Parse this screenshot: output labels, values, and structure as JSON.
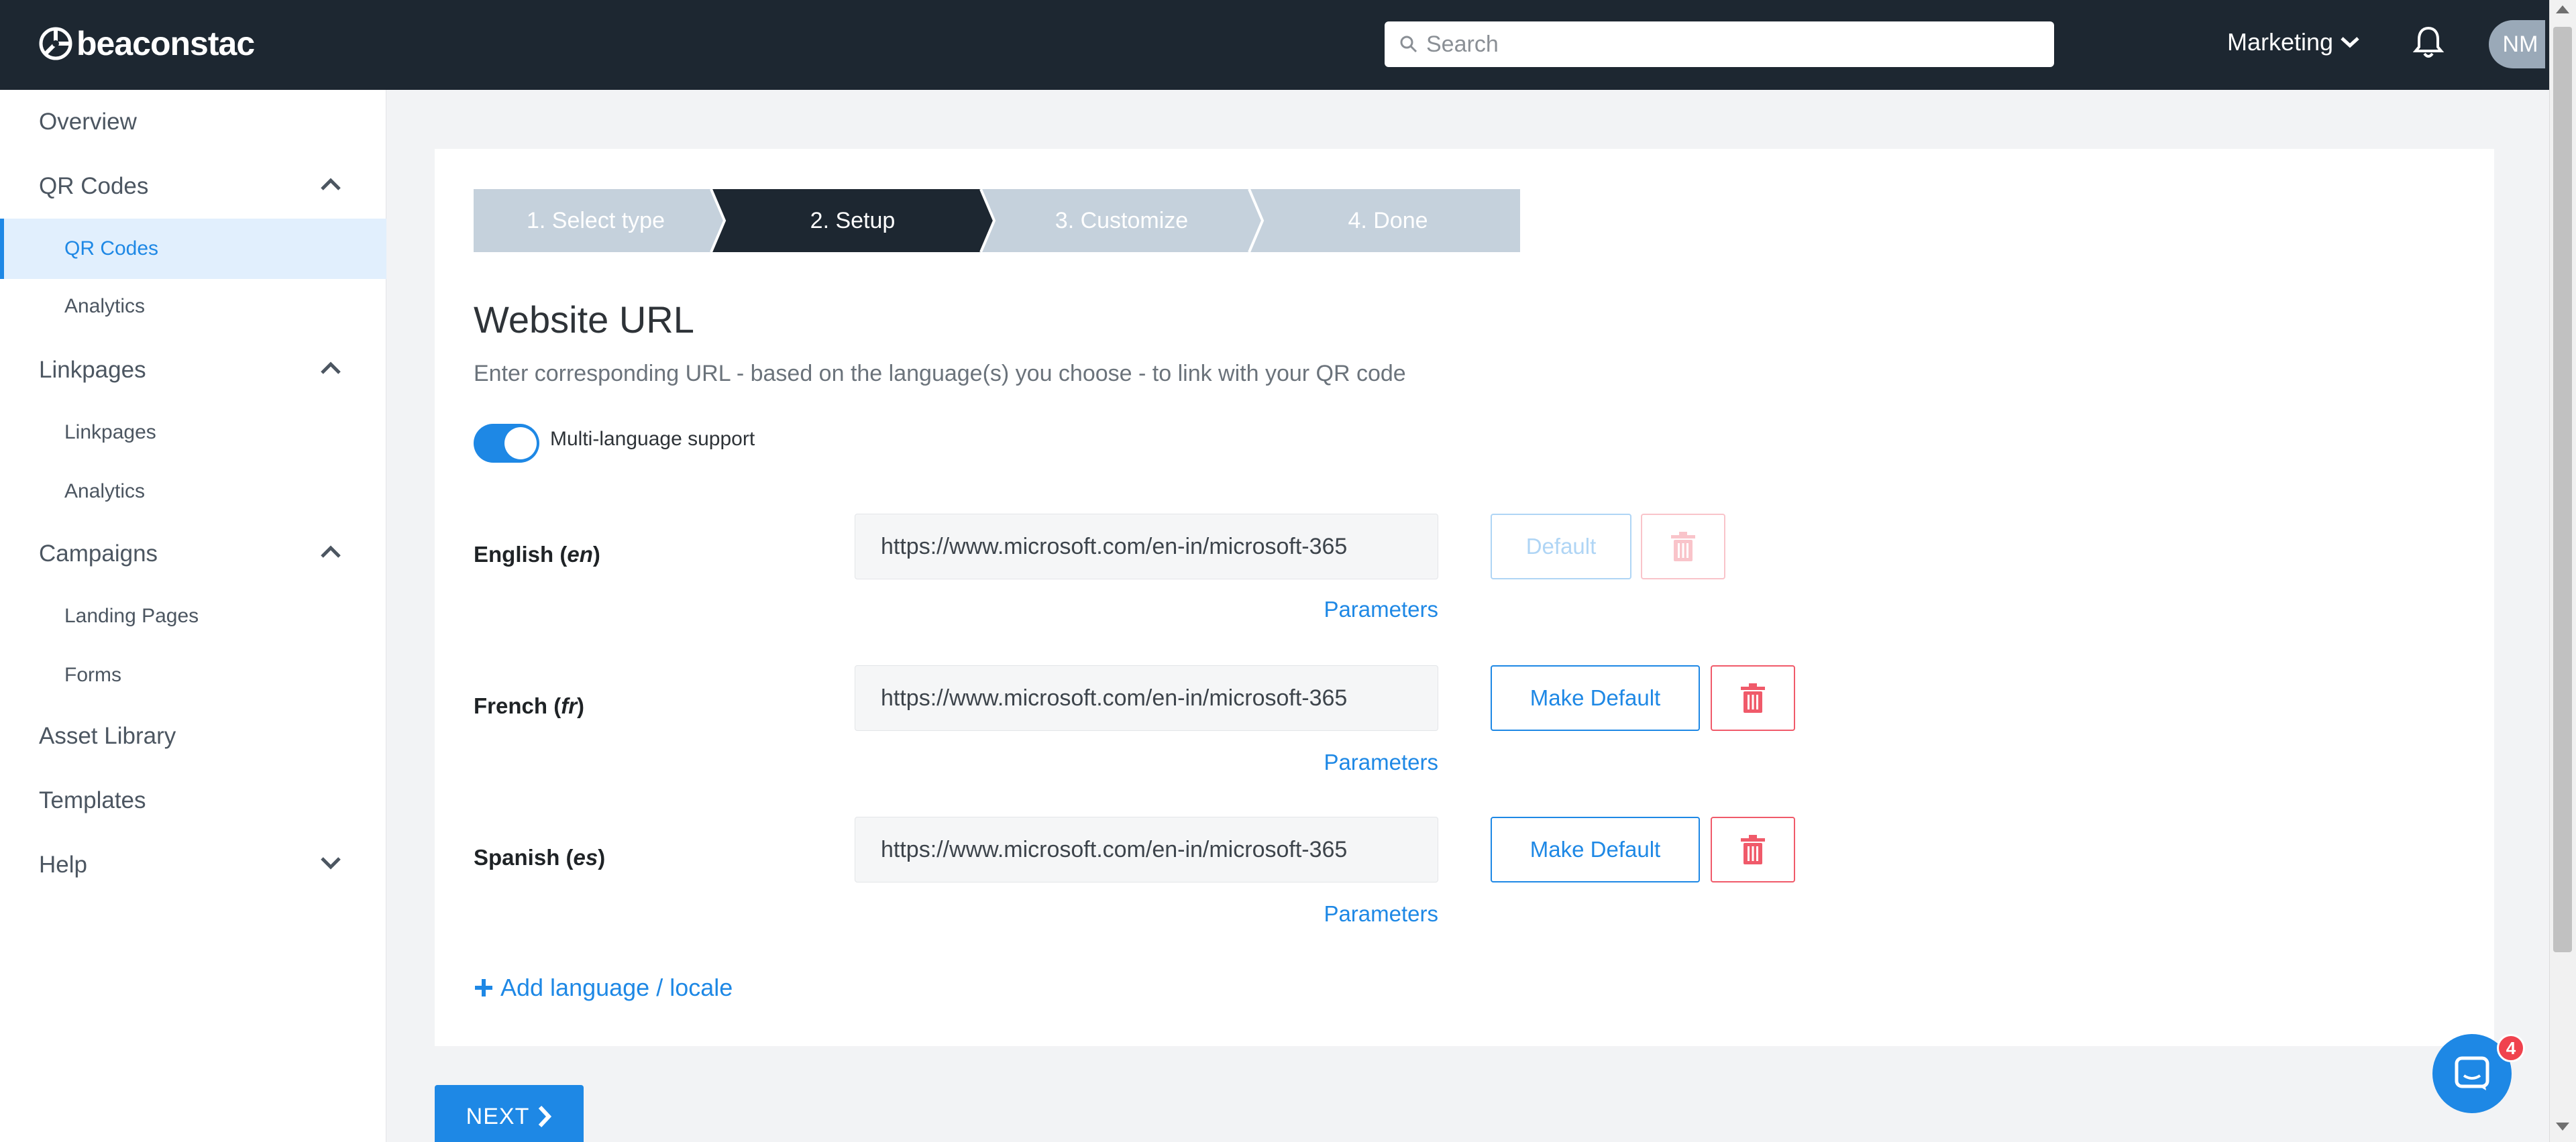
{
  "header": {
    "brand": "beaconstac",
    "search_placeholder": "Search",
    "org_name": "Marketing",
    "avatar_initials": "NM"
  },
  "sidebar": {
    "overview": "Overview",
    "qr_codes_group": "QR Codes",
    "qr_codes": "QR Codes",
    "qr_analytics": "Analytics",
    "linkpages_group": "Linkpages",
    "linkpages": "Linkpages",
    "linkpages_analytics": "Analytics",
    "campaigns_group": "Campaigns",
    "landing_pages": "Landing Pages",
    "forms": "Forms",
    "asset_library": "Asset Library",
    "templates": "Templates",
    "help": "Help"
  },
  "stepper": {
    "steps": [
      "1. Select type",
      "2. Setup",
      "3. Customize",
      "4. Done"
    ],
    "active_index": 1
  },
  "form": {
    "title": "Website URL",
    "subtitle": "Enter corresponding URL - based on the language(s) you choose - to link with your QR code",
    "toggle_label": "Multi-language support",
    "toggle_on": true,
    "languages": [
      {
        "name": "English",
        "code": "en",
        "url": "https://www.microsoft.com/en-in/microsoft-365",
        "params": "Parameters",
        "default_label": "Default",
        "is_default": true
      },
      {
        "name": "French",
        "code": "fr",
        "url": "https://www.microsoft.com/en-in/microsoft-365",
        "params": "Parameters",
        "default_label": "Make Default",
        "is_default": false
      },
      {
        "name": "Spanish",
        "code": "es",
        "url": "https://www.microsoft.com/en-in/microsoft-365",
        "params": "Parameters",
        "default_label": "Make Default",
        "is_default": false
      }
    ],
    "add_language": "Add language / locale",
    "next_label": "NEXT"
  },
  "chat": {
    "badge_count": "4"
  },
  "colors": {
    "topbar": "#1d2731",
    "accent": "#1e88e5",
    "danger": "#f05a6a",
    "step_active": "#1d2731",
    "step_inactive": "#c5d1dc"
  }
}
